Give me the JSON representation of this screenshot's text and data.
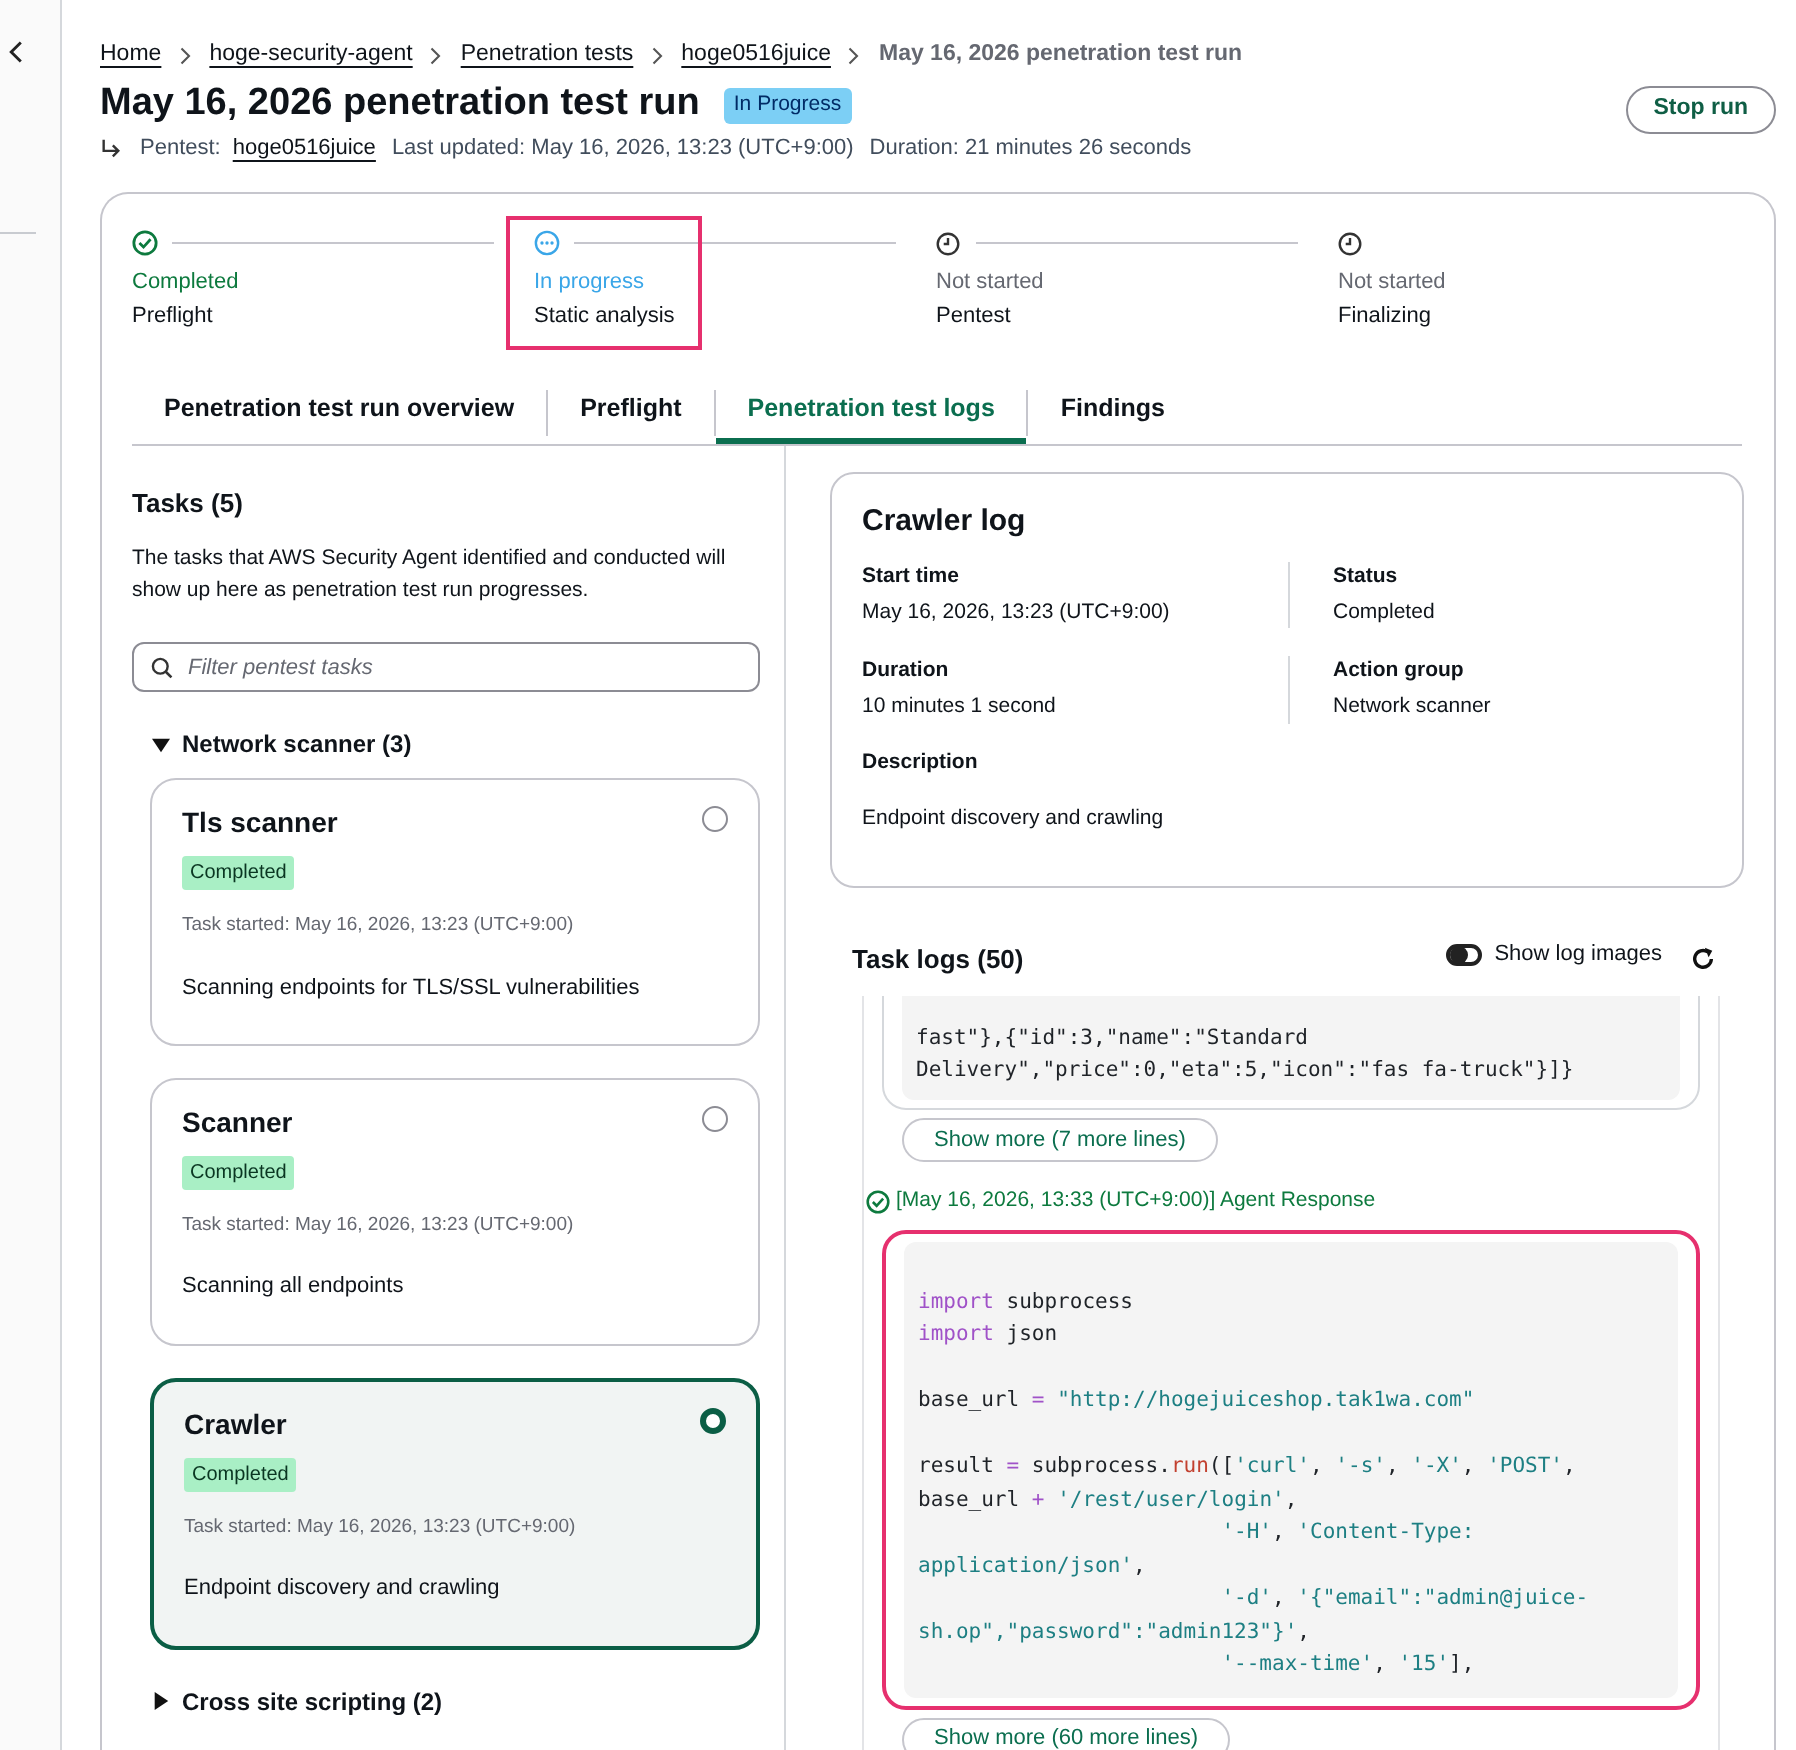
{
  "breadcrumbs": [
    {
      "label": "Home",
      "link": true
    },
    {
      "label": "hoge-security-agent",
      "link": true
    },
    {
      "label": "Penetration tests",
      "link": true
    },
    {
      "label": "hoge0516juice",
      "link": true
    },
    {
      "label": "May 16, 2026 penetration test run",
      "link": false
    }
  ],
  "title": "May 16, 2026 penetration test run",
  "status_badge": "In Progress",
  "subtitle": {
    "pentest_label": "Pentest:",
    "pentest_link": "hoge0516juice",
    "last_updated": "Last updated: May 16, 2026, 13:23 (UTC+9:00)",
    "duration": "Duration: 21 minutes 26 seconds"
  },
  "stop_button": "Stop run",
  "steps": [
    {
      "kind": "completed",
      "status": "Completed",
      "label": "Preflight",
      "highlighted": false
    },
    {
      "kind": "in_progress",
      "status": "In progress",
      "label": "Static analysis",
      "highlighted": true
    },
    {
      "kind": "not_started",
      "status": "Not started",
      "label": "Pentest",
      "highlighted": false
    },
    {
      "kind": "not_started",
      "status": "Not started",
      "label": "Finalizing",
      "highlighted": false
    }
  ],
  "tabs": [
    {
      "label": "Penetration test run overview",
      "selected": false
    },
    {
      "label": "Preflight",
      "selected": false
    },
    {
      "label": "Penetration test logs",
      "selected": true
    },
    {
      "label": "Findings",
      "selected": false
    }
  ],
  "tasks": {
    "title": "Tasks (5)",
    "description": "The tasks that AWS Security Agent identified and conducted will show up here as penetration test run progresses.",
    "filter_placeholder": "Filter pentest tasks",
    "groups": [
      {
        "label": "Network scanner (3)",
        "expanded": true,
        "items": [
          {
            "name": "Tls scanner",
            "badge": "Completed",
            "started": "Task started: May 16, 2026, 13:23 (UTC+9:00)",
            "description": "Scanning endpoints for TLS/SSL vulnerabilities",
            "selected": false
          },
          {
            "name": "Scanner",
            "badge": "Completed",
            "started": "Task started: May 16, 2026, 13:23 (UTC+9:00)",
            "description": "Scanning all endpoints",
            "selected": false
          },
          {
            "name": "Crawler",
            "badge": "Completed",
            "started": "Task started: May 16, 2026, 13:23 (UTC+9:00)",
            "description": "Endpoint discovery and crawling",
            "selected": true
          }
        ]
      },
      {
        "label": "Cross site scripting (2)",
        "expanded": false
      }
    ]
  },
  "detail": {
    "title": "Crawler log",
    "fields": [
      {
        "label": "Start time",
        "value": "May 16, 2026, 13:23 (UTC+9:00)"
      },
      {
        "label": "Status",
        "value": "Completed"
      },
      {
        "label": "Duration",
        "value": "10 minutes 1 second"
      },
      {
        "label": "Action group",
        "value": "Network scanner"
      }
    ],
    "description_label": "Description",
    "description": "Endpoint discovery and crawling"
  },
  "logs": {
    "title": "Task logs (50)",
    "show_images": {
      "label": "Show log images",
      "on": false
    },
    "entries": [
      {
        "highlighted": false,
        "code_groups": [
          [
            [
              {
                "kind": "plain",
                "text": "fast\"},{\"id\":3,\"name\":\"Standard"
              }
            ],
            [
              {
                "kind": "plain",
                "text": "Delivery\",\"price\":0,\"eta\":5,\"icon\":\"fas fa-truck\"}]}"
              }
            ]
          ]
        ],
        "show_more": "Show more (7 more lines)"
      },
      {
        "header": "[May 16, 2026, 13:33 (UTC+9:00)] Agent Response",
        "highlighted": true,
        "code_groups": [
          [
            [
              {
                "kind": "keyword",
                "text": "import"
              },
              {
                "kind": "plain",
                "text": " subprocess"
              }
            ],
            [
              {
                "kind": "keyword",
                "text": "import"
              },
              {
                "kind": "plain",
                "text": " json"
              }
            ]
          ],
          [
            [
              {
                "kind": "plain",
                "text": "base_url "
              },
              {
                "kind": "operator",
                "text": "= "
              },
              {
                "kind": "string",
                "text": "\"http://hogejuiceshop.tak1wa.com\""
              }
            ]
          ],
          [
            [
              {
                "kind": "plain",
                "text": "result "
              },
              {
                "kind": "operator",
                "text": "="
              },
              {
                "kind": "plain",
                "text": " subprocess."
              },
              {
                "kind": "function",
                "text": "run"
              },
              {
                "kind": "plain",
                "text": "(["
              },
              {
                "kind": "string",
                "text": "'curl'"
              },
              {
                "kind": "plain",
                "text": ", "
              },
              {
                "kind": "string",
                "text": "'-s'"
              },
              {
                "kind": "plain",
                "text": ", "
              },
              {
                "kind": "string",
                "text": "'-X'"
              },
              {
                "kind": "plain",
                "text": ", "
              },
              {
                "kind": "string",
                "text": "'POST'"
              },
              {
                "kind": "plain",
                "text": ","
              }
            ],
            [
              {
                "kind": "plain",
                "text": "base_url "
              },
              {
                "kind": "operator",
                "text": "+ "
              },
              {
                "kind": "string",
                "text": "'/rest/user/login'"
              },
              {
                "kind": "plain",
                "text": ","
              }
            ],
            [
              {
                "kind": "string",
                "text": "                        '-H'"
              },
              {
                "kind": "plain",
                "text": ", "
              },
              {
                "kind": "string",
                "text": "'Content-Type:"
              }
            ],
            [
              {
                "kind": "string",
                "text": "application/json'"
              },
              {
                "kind": "plain",
                "text": ","
              }
            ],
            [
              {
                "kind": "string",
                "text": "                        '-d'"
              },
              {
                "kind": "plain",
                "text": ", "
              },
              {
                "kind": "string",
                "text": "'{\"email\":\"admin@juice-"
              }
            ],
            [
              {
                "kind": "string",
                "text": "sh.op\",\"password\":\"admin123\"}'"
              },
              {
                "kind": "plain",
                "text": ","
              }
            ],
            [
              {
                "kind": "string",
                "text": "                        '--max-time'"
              },
              {
                "kind": "plain",
                "text": ", "
              },
              {
                "kind": "string",
                "text": "'15'"
              },
              {
                "kind": "plain",
                "text": "],"
              }
            ]
          ]
        ],
        "show_more": "Show more (60 more lines)"
      }
    ]
  }
}
